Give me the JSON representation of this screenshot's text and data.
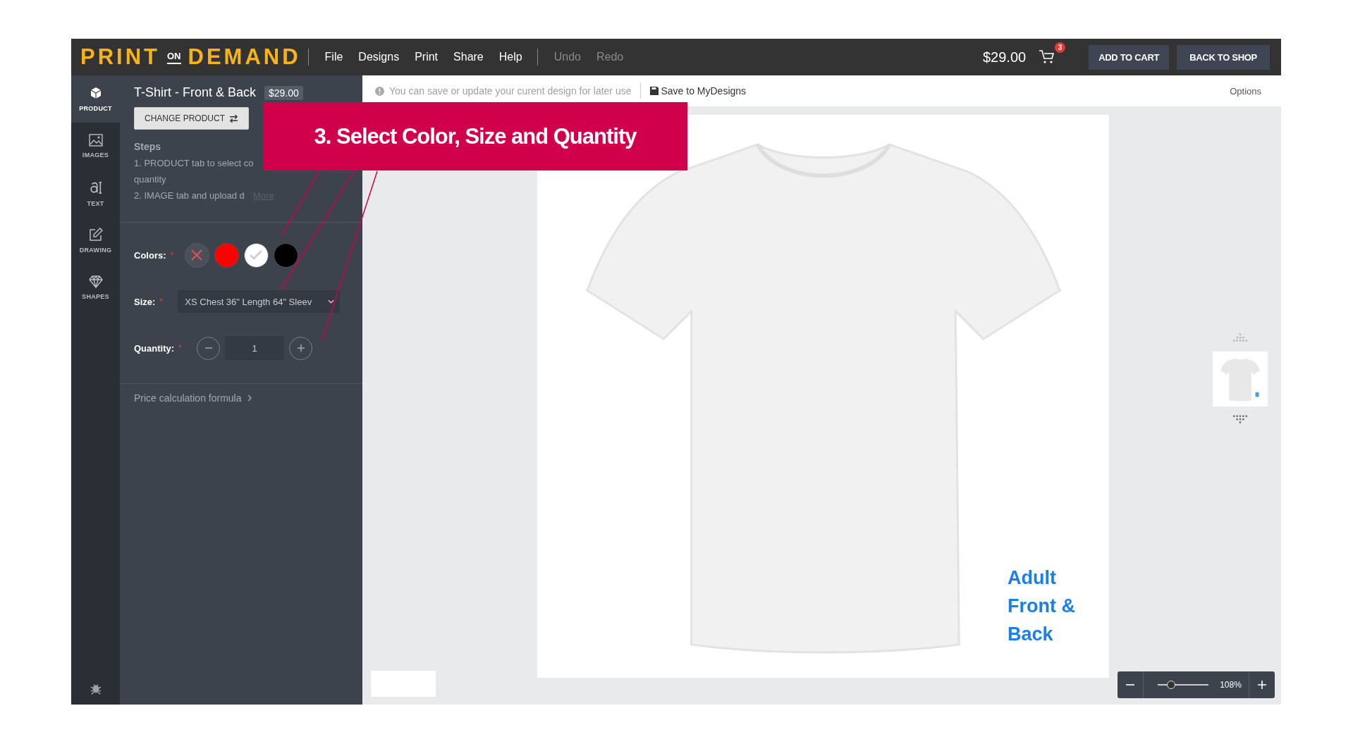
{
  "brand": {
    "word_1": "PRINT",
    "word_2": "ON",
    "word_3": "DEMAND"
  },
  "menu": [
    {
      "label": "File",
      "disabled": false
    },
    {
      "label": "Designs",
      "disabled": false
    },
    {
      "label": "Print",
      "disabled": false
    },
    {
      "label": "Share",
      "disabled": false
    },
    {
      "label": "Help",
      "disabled": false
    },
    {
      "label": "Undo",
      "disabled": true
    },
    {
      "label": "Redo",
      "disabled": true
    }
  ],
  "cart": {
    "total": "$29.00",
    "count": "3"
  },
  "header_buttons": [
    "ADD TO CART",
    "BACK TO SHOP"
  ],
  "sidebar": {
    "items": [
      {
        "label": "PRODUCT",
        "kind": "cube",
        "selected": true
      },
      {
        "label": "IMAGES",
        "kind": "image",
        "selected": false
      },
      {
        "label": "TEXT",
        "kind": "text",
        "selected": false
      },
      {
        "label": "DRAWING",
        "kind": "drawing",
        "selected": false
      },
      {
        "label": "SHAPES",
        "kind": "shapes",
        "selected": false
      }
    ]
  },
  "product": {
    "title": "T-Shirt - Front & Back",
    "price": "$29.00",
    "change_button": "CHANGE PRODUCT",
    "steps_heading": "Steps",
    "steps": [
      "1. PRODUCT tab to select co",
      "quantity",
      "2. IMAGE tab and upload d"
    ],
    "more_link": "More"
  },
  "colors": {
    "label": "Colors:",
    "required_mark": "*",
    "swatches": [
      {
        "kind": "none",
        "selected": false
      },
      {
        "kind": "color",
        "color": "#ff0000",
        "selected": false
      },
      {
        "kind": "color",
        "color": "#ffffff",
        "selected": true
      },
      {
        "kind": "color",
        "color": "#000000",
        "selected": false
      }
    ]
  },
  "size": {
    "label": "Size:",
    "required_mark": "*",
    "value": "XS Chest 36\" Length 64\" Sleev"
  },
  "quantity": {
    "label": "Quantity:",
    "required_mark": "*",
    "value": "1"
  },
  "price_formula": "Price calculation formula",
  "info_bar": {
    "message": "You can save or update your curent design for later use",
    "save": "Save to MyDesigns",
    "options": "Options"
  },
  "canvas": {
    "label_lines": [
      "Adult",
      "Front &",
      "Back"
    ]
  },
  "zoom": {
    "level": 0.3,
    "reading": "108%"
  },
  "callout": {
    "text": "3. Select Color, Size and Quantity"
  }
}
